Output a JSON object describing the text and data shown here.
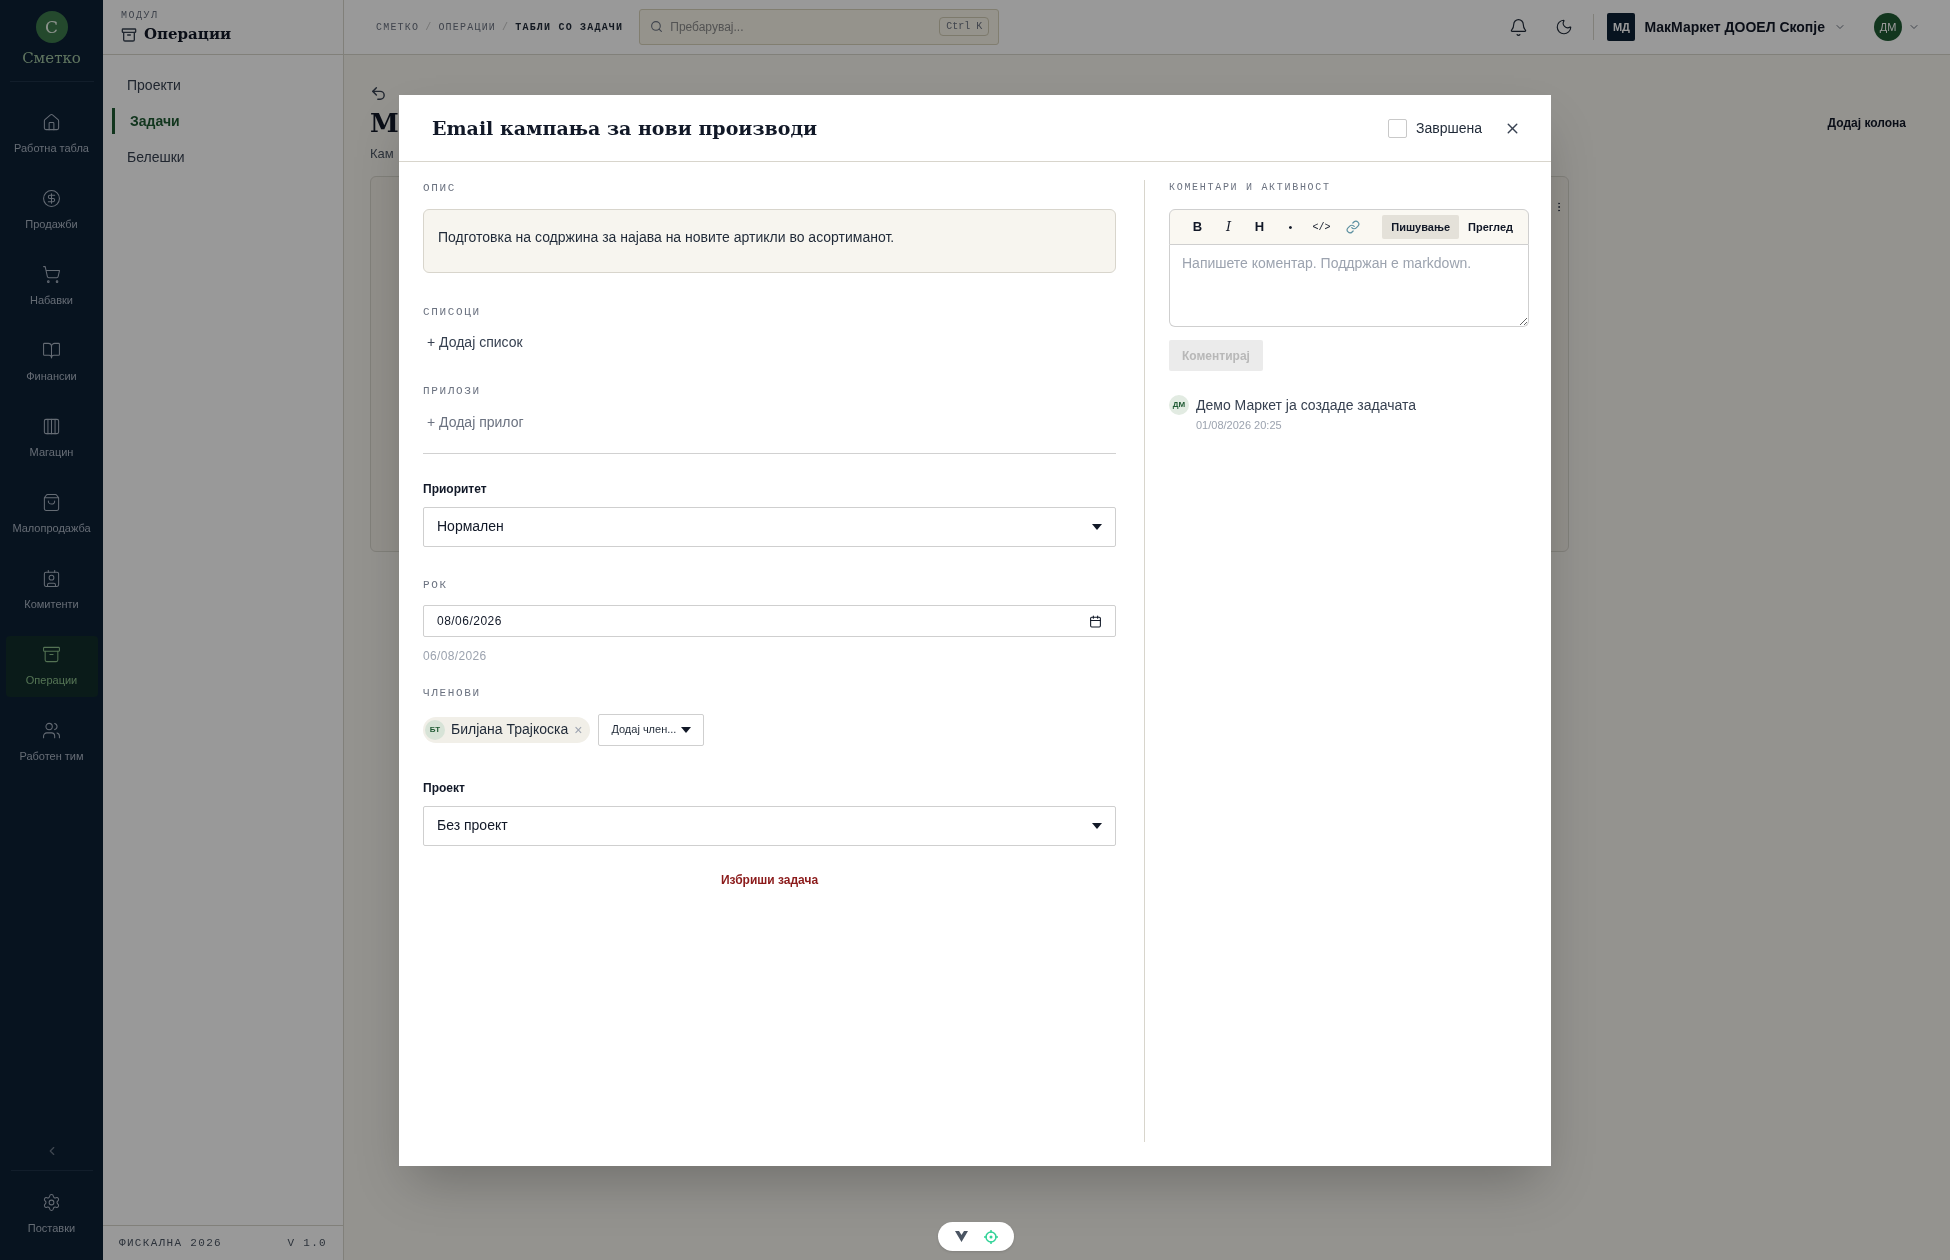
{
  "rail": {
    "logo_letter": "С",
    "logo_name": "Сметко",
    "items": [
      {
        "label": "Работна табла",
        "selected": false
      },
      {
        "label": "Продажби",
        "selected": false
      },
      {
        "label": "Набавки",
        "selected": false
      },
      {
        "label": "Финансии",
        "selected": false
      },
      {
        "label": "Магацин",
        "selected": false
      },
      {
        "label": "Малопродажба",
        "selected": false
      },
      {
        "label": "Комитенти",
        "selected": false
      },
      {
        "label": "Операции",
        "selected": true
      },
      {
        "label": "Работен тим",
        "selected": false
      }
    ],
    "settings": "Поставки"
  },
  "module_sidebar": {
    "caption": "МОДУЛ",
    "title": "Операции",
    "items": [
      {
        "label": "Проекти",
        "selected": false
      },
      {
        "label": "Задачи",
        "selected": true
      },
      {
        "label": "Белешки",
        "selected": false
      }
    ],
    "footer_left": "ФИСКАЛНА 2026",
    "footer_right": "V 1.0"
  },
  "topbar": {
    "breadcrumb": [
      "СМЕТКО",
      "ОПЕРАЦИИ",
      "ТАБЛИ СО ЗАДАЧИ"
    ],
    "separator": "/",
    "search": {
      "placeholder": "Пребарувај...",
      "shortcut": "Ctrl K"
    },
    "company_badge": "МД",
    "company": "МакМаркет ДООЕЛ Скопје",
    "user_badge": "ДМ"
  },
  "board": {
    "title": "М",
    "subtitle": "Кам",
    "add_column": "Додај колона"
  },
  "modal": {
    "title": "Email кампања за нови производи",
    "done": {
      "label": "Завршена",
      "checked": false
    },
    "description": {
      "label": "ОПИС",
      "text": "Подготовка на содржина за најава на новите артикли во асортиманот."
    },
    "checklists": {
      "label": "СПИСОЦИ",
      "add": "+ Додај список"
    },
    "attachments": {
      "label": "ПРИЛОЗИ",
      "add": "+ Додај прилог"
    },
    "priority": {
      "label": "Приоритет",
      "value": "Нормален"
    },
    "due": {
      "label": "РОК",
      "value": "08/06/2026",
      "hint": "06/08/2026"
    },
    "members": {
      "label": "ЧЛЕНОВИ",
      "list": [
        {
          "initials": "БТ",
          "name": "Билјана Трајкоска",
          "remove": "×"
        }
      ],
      "add": "Додај член..."
    },
    "project": {
      "label": "Проект",
      "value": "Без проект"
    },
    "delete": "Избриши задача",
    "comments": {
      "label": "КОМЕНТАРИ И АКТИВНОСТ",
      "toolbar": [
        {
          "kind": "bold",
          "text": "B"
        },
        {
          "kind": "italic",
          "text": "I"
        },
        {
          "kind": "heading",
          "text": "H"
        },
        {
          "kind": "bullet",
          "text": "•"
        },
        {
          "kind": "code",
          "text": "</>"
        },
        {
          "kind": "link"
        }
      ],
      "tabs": [
        {
          "label": "Пишување",
          "selected": true
        },
        {
          "label": "Преглед",
          "selected": false
        }
      ],
      "placeholder": "Напишете коментар. Поддржан е markdown.",
      "submit": {
        "label": "Коментирај",
        "disabled": true
      },
      "activity": [
        {
          "initials": "ДМ",
          "text": "Демо Маркет ја создаде задачата",
          "time": "01/08/2026 20:25"
        }
      ]
    }
  }
}
